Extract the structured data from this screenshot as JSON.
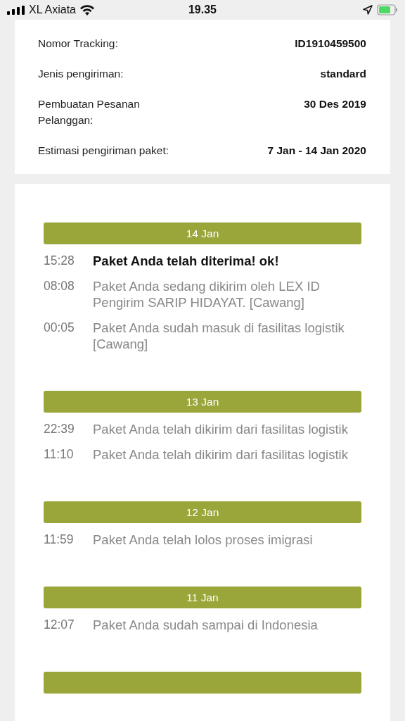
{
  "status_bar": {
    "carrier": "XL Axiata",
    "time": "19.35",
    "battery_charging": true
  },
  "shipment_info": [
    {
      "label": "Nomor Tracking:",
      "value": "ID1910459500"
    },
    {
      "label": "Jenis pengiriman:",
      "value": "standard"
    },
    {
      "label": "Pembuatan Pesanan Pelanggan:",
      "value": "30 Des 2019"
    },
    {
      "label": "Estimasi pengiriman paket:",
      "value": "7 Jan - 14 Jan 2020"
    }
  ],
  "timeline": [
    {
      "date": "14 Jan",
      "events": [
        {
          "time": "15:28",
          "text": "Paket Anda telah diterima! ok!",
          "latest": true
        },
        {
          "time": "08:08",
          "text": "Paket Anda sedang dikirim oleh LEX ID Pengirim SARIP HIDAYAT. [Cawang]",
          "latest": false
        },
        {
          "time": "00:05",
          "text": "Paket Anda sudah masuk di fasilitas logistik [Cawang]",
          "latest": false
        }
      ]
    },
    {
      "date": "13 Jan",
      "events": [
        {
          "time": "22:39",
          "text": "Paket Anda telah dikirim dari fasilitas logistik",
          "latest": false
        },
        {
          "time": "11:10",
          "text": "Paket Anda telah dikirim dari fasilitas logistik",
          "latest": false
        }
      ]
    },
    {
      "date": "12 Jan",
      "events": [
        {
          "time": "11:59",
          "text": "Paket Anda telah lolos proses imigrasi",
          "latest": false
        }
      ]
    },
    {
      "date": "11 Jan",
      "events": [
        {
          "time": "12:07",
          "text": "Paket Anda sudah sampai di Indonesia",
          "latest": false
        }
      ]
    }
  ]
}
